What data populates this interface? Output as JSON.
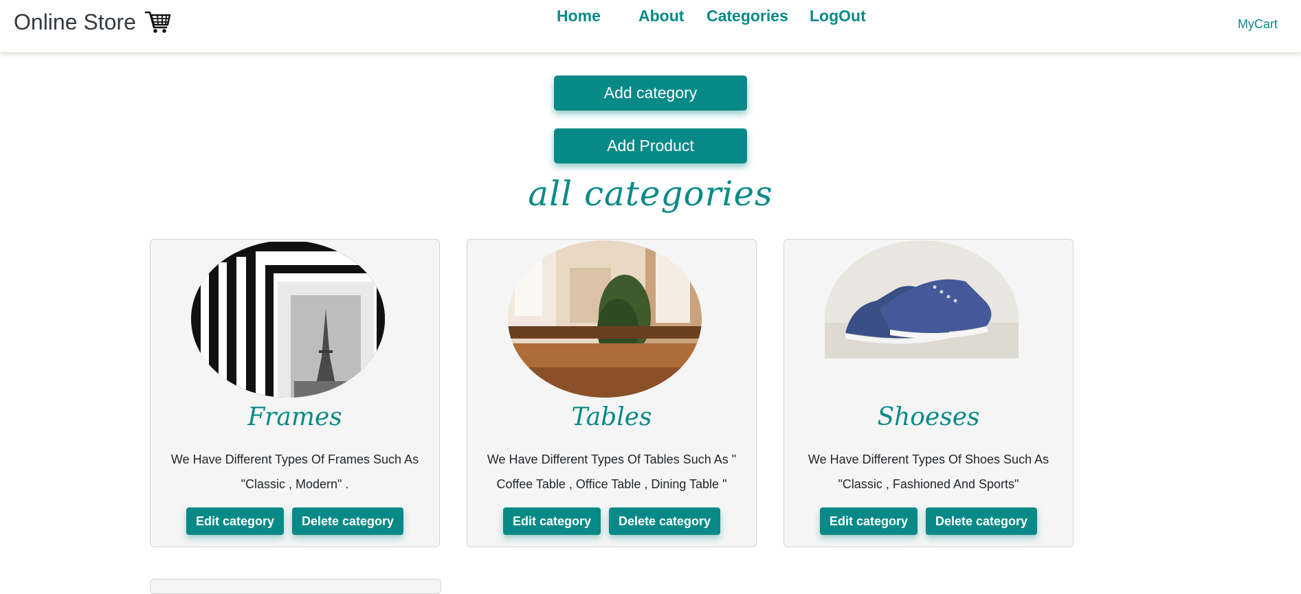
{
  "header": {
    "brand": "Online Store",
    "brand_icon": "shopping-cart-icon",
    "nav": {
      "home": "Home",
      "about": "About",
      "categories": "Categories",
      "logout": "LogOut"
    },
    "mycart": "MyCart"
  },
  "actions": {
    "add_category": "Add category",
    "add_product": "Add Product"
  },
  "section_title": "all categories",
  "categories": [
    {
      "name": "Frames",
      "description": "We Have Different Types Of Frames Such As \"Classic , Modern\" .",
      "image": "frames-image",
      "edit_label": "Edit category",
      "delete_label": "Delete category"
    },
    {
      "name": "Tables",
      "description": "We Have Different Types Of Tables Such As \" Coffee Table , Office Table , Dining Table \"",
      "image": "tables-image",
      "edit_label": "Edit category",
      "delete_label": "Delete category"
    },
    {
      "name": "Shoeses",
      "description": "We Have Different Types Of Shoes Such As \"Classic , Fashioned And Sports\"",
      "image": "shoes-image",
      "edit_label": "Edit category",
      "delete_label": "Delete category"
    }
  ],
  "colors": {
    "accent": "#078a87",
    "brand_text": "#343a40",
    "card_bg": "#f5f5f5"
  }
}
